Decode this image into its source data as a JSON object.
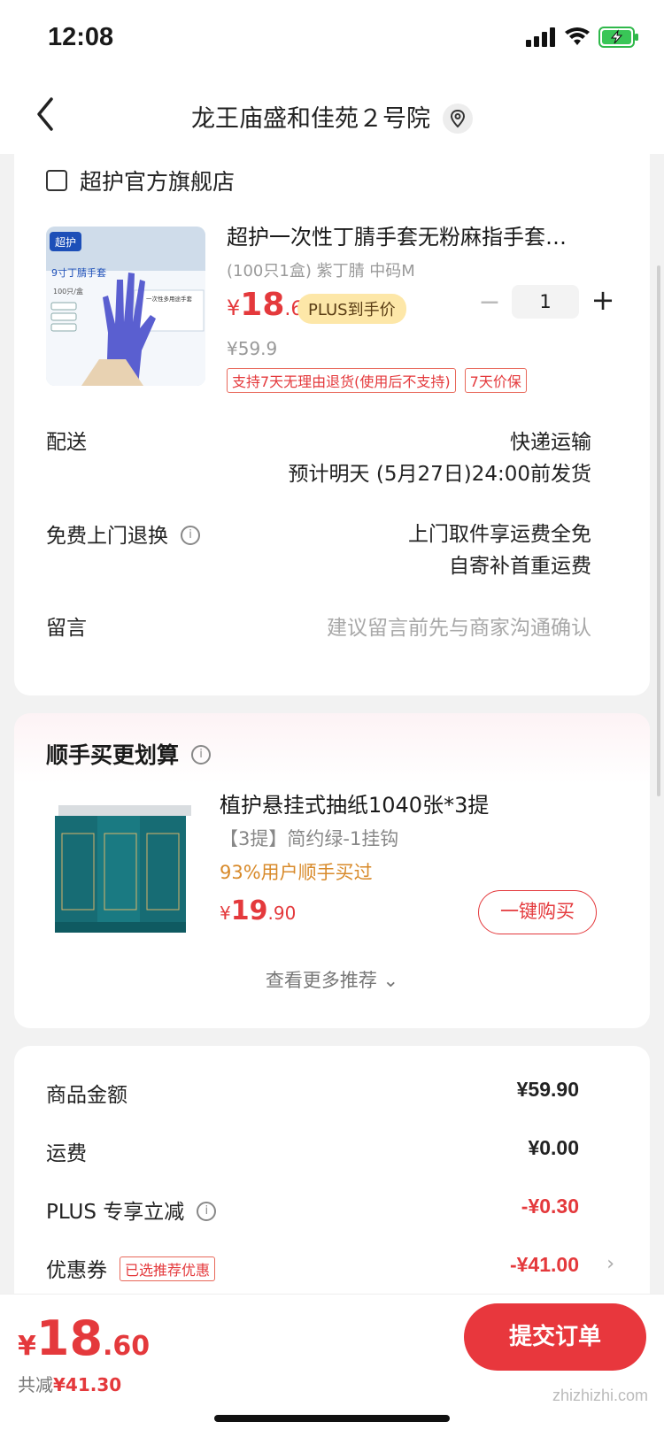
{
  "status": {
    "time": "12:08"
  },
  "nav": {
    "title": "龙王庙盛和佳苑２号院"
  },
  "store": {
    "name": "超护官方旗舰店"
  },
  "product": {
    "title": "超护一次性丁腈手套无粉麻指手套…",
    "spec": "(100只1盒) 紫丁腈 中码M",
    "price_cur": "¥",
    "price_int": "18",
    "price_dec": ".6",
    "plus_label": "PLUS到手价",
    "orig_price": "¥59.9",
    "qty": "1",
    "qty_minus": "−",
    "qty_plus": "+",
    "tags": [
      "支持7天无理由退货(使用后不支持)",
      "7天价保"
    ],
    "img_labels": {
      "brand": "超护",
      "name": "9寸丁腈手套",
      "count": "100只/盒",
      "box": "一次性多用途手套"
    }
  },
  "delivery": {
    "label": "配送",
    "method": "快递运输",
    "eta": "预计明天 (5月27日)24:00前发货"
  },
  "return": {
    "label": "免费上门退换",
    "line1": "上门取件享运费全免",
    "line2": "自寄补首重运费"
  },
  "message": {
    "label": "留言",
    "placeholder": "建议留言前先与商家沟通确认"
  },
  "recommend": {
    "title": "顺手买更划算",
    "item_title": "植护悬挂式抽纸1040张*3提",
    "item_spec": "【3提】简约绿-1挂钩",
    "item_hint": "93%用户顺手买过",
    "price_cur": "¥",
    "price_int": "19",
    "price_dec": ".90",
    "buy_label": "一键购买",
    "more_label": "查看更多推荐 ⌄"
  },
  "summary": {
    "goods_label": "商品金额",
    "goods_value": "¥59.90",
    "shipping_label": "运费",
    "shipping_value": "¥0.00",
    "plus_label": "PLUS 专享立减",
    "plus_value": "-¥0.30",
    "coupon_label": "优惠券",
    "coupon_tag": "已选推荐优惠",
    "coupon_value": "-¥41.00"
  },
  "bottom": {
    "total_cur": "¥",
    "total_int": "18",
    "total_dec": ".60",
    "save_label": "共减",
    "save_value": "¥41.30",
    "submit_label": "提交订单"
  },
  "watermark": "zhizhizhi.com",
  "colors": {
    "accent": "#e4393c",
    "plus_badge": "#fde7a8",
    "hint": "#d88a2a"
  }
}
